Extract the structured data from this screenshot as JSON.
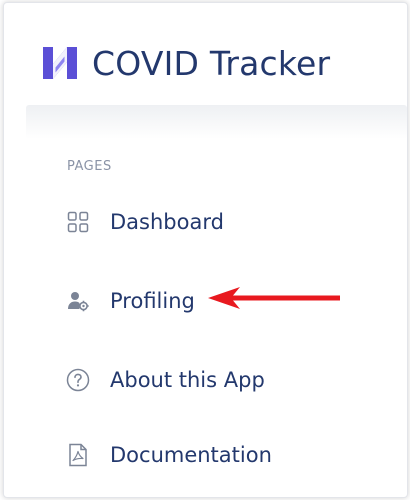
{
  "brand": {
    "title": "COVID Tracker",
    "logo_icon": "brand-logo-icon"
  },
  "sidebar": {
    "section_label": "PAGES",
    "items": [
      {
        "label": "Dashboard",
        "icon": "grid-icon"
      },
      {
        "label": "Profiling",
        "icon": "user-gear-icon"
      },
      {
        "label": "About this App",
        "icon": "question-circle-icon"
      },
      {
        "label": "Documentation",
        "icon": "pdf-document-icon"
      }
    ]
  },
  "annotation": {
    "arrow_color": "#e8191f"
  },
  "colors": {
    "brand": "#23386d",
    "logo_accent": "#6f5ddb",
    "muted": "#8a93a6",
    "icon": "#7b8496"
  }
}
